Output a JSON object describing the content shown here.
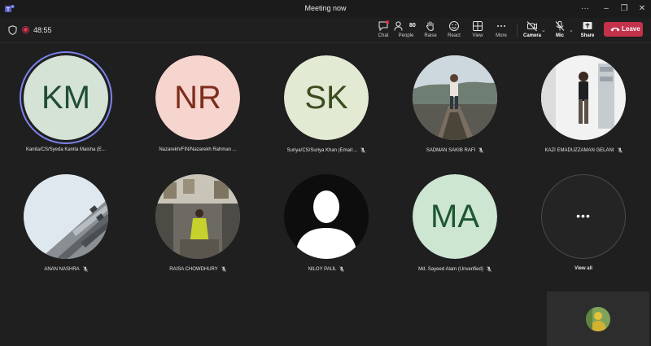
{
  "window": {
    "title": "Meeting now"
  },
  "toolbar": {
    "timer": "48:55",
    "chat": "Chat",
    "people": "People",
    "people_count": "80",
    "raise": "Raise",
    "react": "React",
    "view": "View",
    "more": "More",
    "camera": "Camera",
    "mic": "Mic",
    "share": "Share",
    "leave": "Leave"
  },
  "participants": [
    {
      "name": "Kanita/CS/Syeda Kanita Maisha (E...",
      "initials": "KM",
      "avatar_bg": "#d5e3d6",
      "initials_color": "#214d35",
      "speaking": true
    },
    {
      "name": "Nazarekh/FIN/Nazarekh Rahman ...",
      "initials": "NR",
      "avatar_bg": "#f7d5cf",
      "initials_color": "#7d2e1d"
    },
    {
      "name": "Suriya/CS/Suriya Khan (Email:...",
      "initials": "SK",
      "avatar_bg": "#e3ead4",
      "initials_color": "#3b4d1f"
    },
    {
      "name": "SADMAN SAKIB RAFI",
      "photo": "landscape"
    },
    {
      "name": "KAZI EMADUZZAMAN GELANI",
      "photo": "portrait"
    },
    {
      "name": "ANAN NASHRA",
      "photo": "building"
    },
    {
      "name": "RAISA CHOWDHURY",
      "photo": "room"
    },
    {
      "name": "NILOY PAUL",
      "photo": "silhouette"
    },
    {
      "name": "Md. Sayeed Alam (Unverified)",
      "initials": "MA",
      "avatar_bg": "#cde6d2",
      "initials_color": "#1d5732"
    }
  ],
  "view_all": {
    "label": "View all"
  },
  "colors": {
    "leave": "#c4314b",
    "speaking_ring": "#7b83eb",
    "recording": "#e3354b"
  }
}
